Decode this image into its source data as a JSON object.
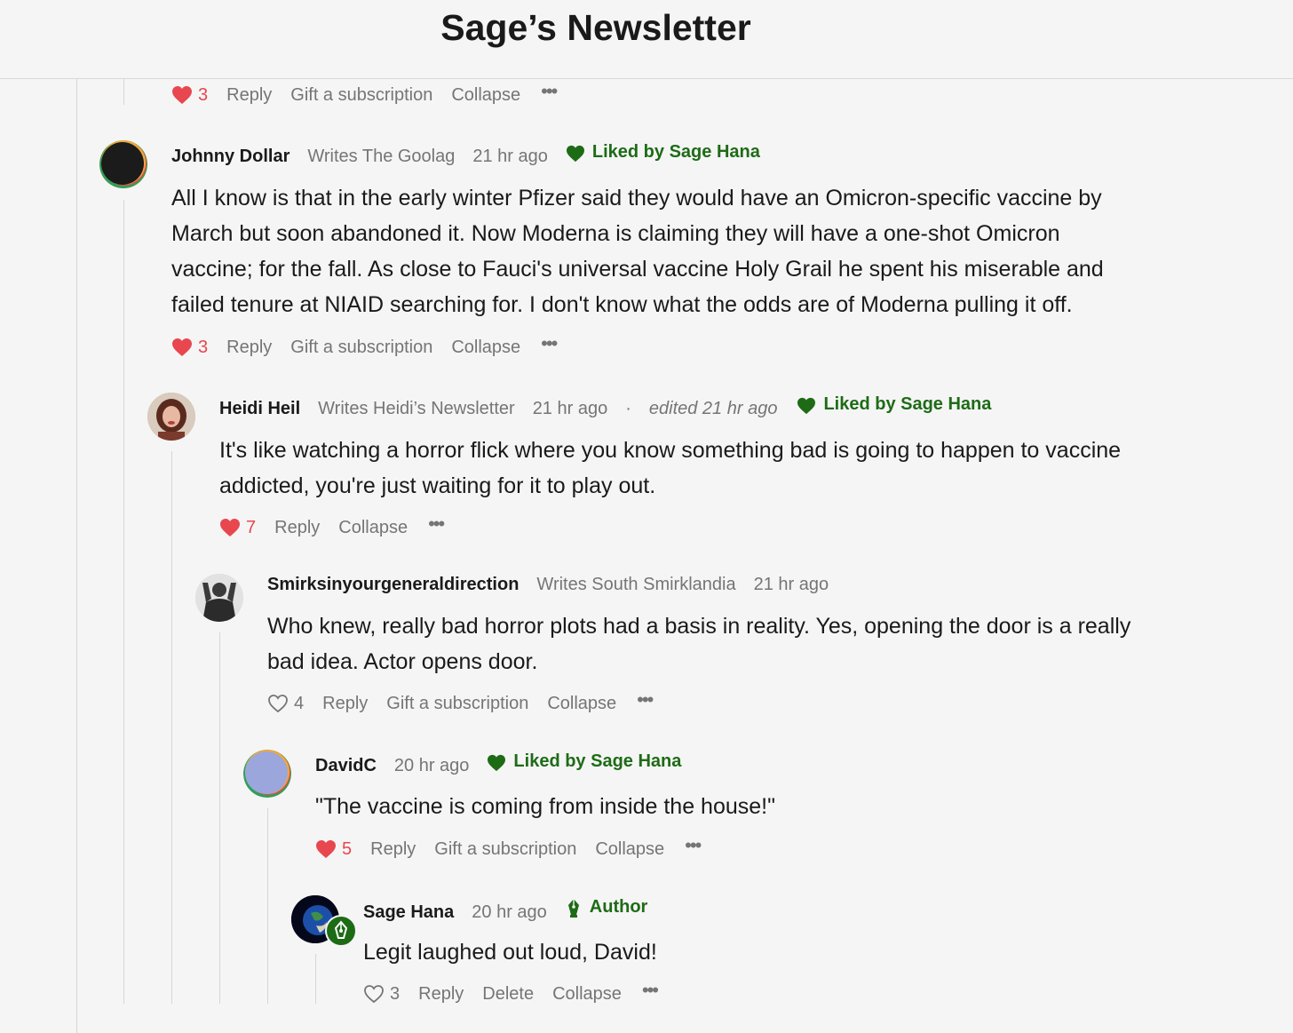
{
  "header": {
    "title": "Sage’s Newsletter"
  },
  "colors": {
    "accent_green": "#1e6b16",
    "heart_red": "#e8474f",
    "muted": "#757575"
  },
  "top_actions": {
    "likes": "3",
    "reply": "Reply",
    "gift": "Gift a subscription",
    "collapse": "Collapse",
    "more": "•••"
  },
  "comments": [
    {
      "author": "Johnny Dollar",
      "writes": "Writes The Goolag",
      "time": "21 hr ago",
      "liked_by": "Liked by Sage Hana",
      "text": "All I know is that in the early winter Pfizer said they would have an Omicron-specific vaccine by March but soon abandoned it. Now Moderna is claiming they will have a one-shot Omicron vaccine; for the fall. As close to Fauci's universal vaccine Holy Grail he spent his miserable and failed tenure at NIAID searching for. I don't know what the odds are of Moderna pulling it off.",
      "likes": "3",
      "reply": "Reply",
      "gift": "Gift a subscription",
      "collapse": "Collapse",
      "more": "•••"
    },
    {
      "author": "Heidi Heil",
      "writes": "Writes Heidi’s Newsletter",
      "time": "21 hr ago",
      "dot": "·",
      "edited": "edited 21 hr ago",
      "liked_by": "Liked by Sage Hana",
      "text": "It's like watching a horror flick where you know something bad is going to happen to vaccine addicted, you're just waiting for it to play out.",
      "likes": "7",
      "reply": "Reply",
      "collapse": "Collapse",
      "more": "•••"
    },
    {
      "author": "Smirksinyourgeneraldirection",
      "writes": "Writes South Smirklandia",
      "time": "21 hr ago",
      "text": "Who knew, really bad horror plots had a basis in reality. Yes, opening the door is a really bad idea. Actor opens door.",
      "likes": "4",
      "reply": "Reply",
      "gift": "Gift a subscription",
      "collapse": "Collapse",
      "more": "•••"
    },
    {
      "author": "DavidC",
      "time": "20 hr ago",
      "liked_by": "Liked by Sage Hana",
      "text": "\"The vaccine is coming from inside the house!\"",
      "likes": "5",
      "reply": "Reply",
      "gift": "Gift a subscription",
      "collapse": "Collapse",
      "more": "•••"
    },
    {
      "author": "Sage Hana",
      "time": "20 hr ago",
      "badge": "Author",
      "text": "Legit laughed out loud, David!",
      "likes": "3",
      "reply": "Reply",
      "delete": "Delete",
      "collapse": "Collapse",
      "more": "•••"
    }
  ]
}
